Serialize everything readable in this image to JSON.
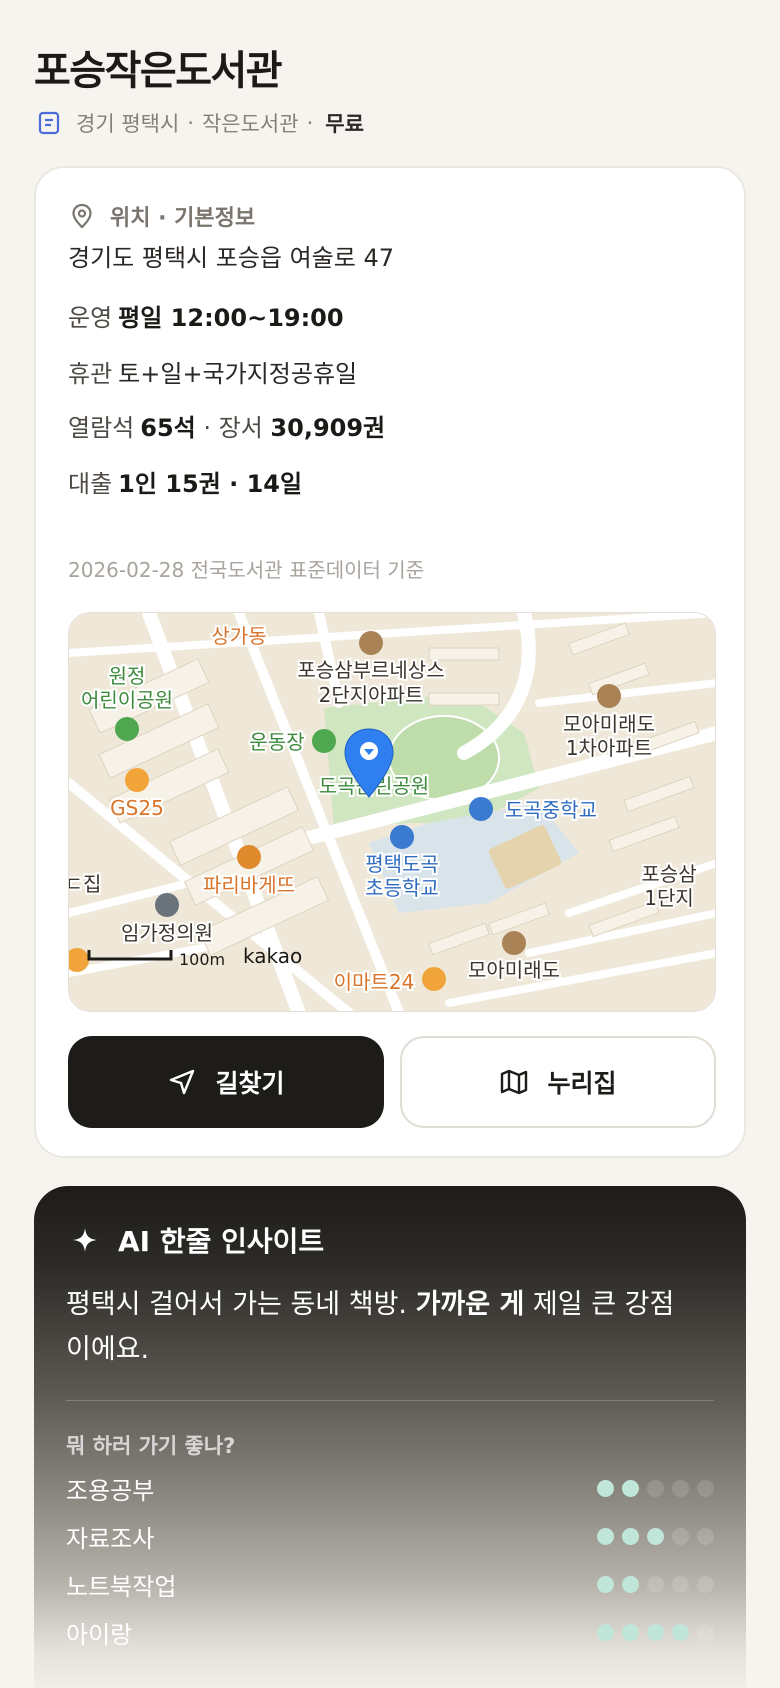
{
  "header": {
    "title": "포승작은도서관",
    "region": "경기 평택시",
    "type": "작은도서관",
    "sep1": "·",
    "sep2": "·",
    "fee": "무료"
  },
  "info": {
    "section_title": "위치 · 기본정보",
    "address": "경기도 평택시 포승읍 여술로 47",
    "hours_label": "운영",
    "hours_value": "평일 12:00~19:00",
    "closed_label": "휴관",
    "closed_value": "토+일+국가지정공휴일",
    "seats_label": "열람석",
    "seats_value": "65석",
    "books_sep": " · 장서 ",
    "books_value": "30,909권",
    "loan_label": "대출",
    "loan_value": "1인 15권 · 14일",
    "data_note": "2026-02-28 전국도서관 표준데이터 기준"
  },
  "map": {
    "labels": {
      "sangga": "상가동",
      "poseung_apt_1": "포승삼부르네상스",
      "poseung_apt_2": "2단지아파트",
      "park_1": "원정",
      "park_2": "어린이공원",
      "mora_1": "모아미래도",
      "mora_2": "1차아파트",
      "field": "운동장",
      "dogok_park": "도곡근린공원",
      "gs25": "GS25",
      "dogok_middle": "도곡중학교",
      "paris": "파리바게뜨",
      "elem_1": "평택도곡",
      "elem_2": "초등학교",
      "poseung_right_1": "포승삼",
      "poseung_right_2": "1단지",
      "jip": "ㄷ집",
      "clinic": "임가정의원",
      "scale": "100m",
      "kakao": "kakao",
      "emart": "이마트24",
      "mora_bottom": "모아미래도"
    },
    "colors": {
      "land": "#efe8d9",
      "road": "#ffffff",
      "park": "#cfe6c0",
      "school": "#d9e6ee",
      "pin": "#2f7ff0"
    }
  },
  "buttons": {
    "directions": "길찾기",
    "nurijip": "누리집"
  },
  "ai": {
    "title": "AI 한줄 인사이트",
    "text_before": "평택시 걸어서 가는 동네 책방. ",
    "text_bold": "가까운 게",
    "text_after": " 제일 큰 강점이에요.",
    "question": "뭐 하러 가기 좋나?",
    "activities": [
      {
        "label": "조용공부",
        "score": 2,
        "max": 5
      },
      {
        "label": "자료조사",
        "score": 3,
        "max": 5
      },
      {
        "label": "노트북작업",
        "score": 2,
        "max": 5
      },
      {
        "label": "아이랑",
        "score": 4,
        "max": 5
      }
    ]
  }
}
